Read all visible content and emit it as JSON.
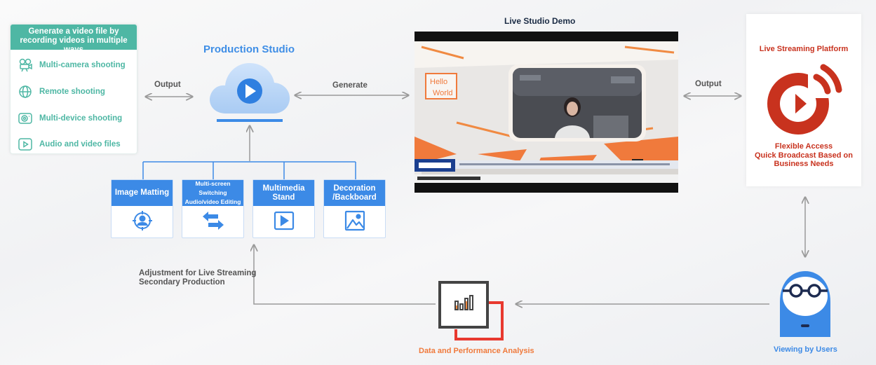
{
  "sources": {
    "header": "Generate a video file by recording videos in multiple ways",
    "items": [
      {
        "label": "Multi-camera shooting",
        "icon": "camera-icon"
      },
      {
        "label": "Remote shooting",
        "icon": "globe-icon"
      },
      {
        "label": "Multi-device shooting",
        "icon": "devices-icon"
      },
      {
        "label": "Audio and video files",
        "icon": "play-file-icon"
      }
    ]
  },
  "flow": {
    "output_left": "Output",
    "generate": "Generate",
    "output_right": "Output",
    "adjustment_line1": "Adjustment for Live Streaming",
    "adjustment_line2": "Secondary Production"
  },
  "studio": {
    "title": "Production Studio",
    "tools": [
      {
        "label": "Image Matting",
        "icon": "user-target-icon"
      },
      {
        "label": "Multi-screen Switching Audio/video Editing",
        "icon": "switch-arrows-icon"
      },
      {
        "label": "Multimedia Stand",
        "icon": "play-screen-icon"
      },
      {
        "label": "Decoration /Backboard",
        "icon": "image-icon"
      }
    ]
  },
  "demo": {
    "title": "Live Studio Demo",
    "overlay_text_line1": "Hello",
    "overlay_text_line2": "World"
  },
  "platform": {
    "title": "Live Streaming Platform",
    "line1": "Flexible Access",
    "line2": "Quick Broadcast Based on",
    "line3": "Business Needs"
  },
  "analysis": {
    "label": "Data and Performance Analysis"
  },
  "users": {
    "label": "Viewing by Users"
  },
  "colors": {
    "teal": "#4eb7a4",
    "blue": "#3c8ae6",
    "red": "#c8321e",
    "orange": "#f07a3c"
  }
}
